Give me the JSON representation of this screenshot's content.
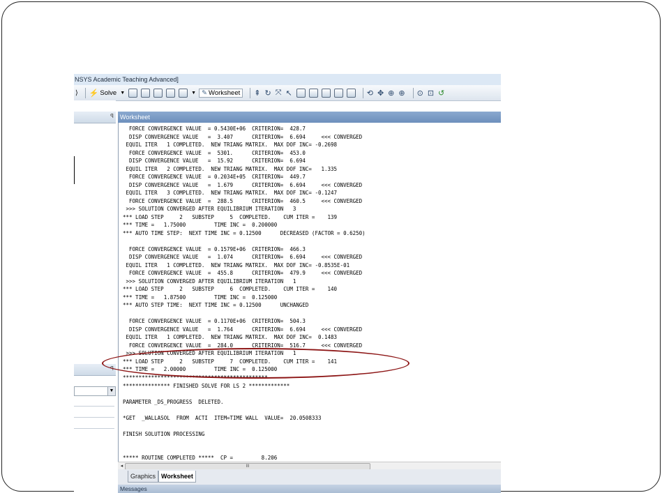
{
  "window": {
    "title": "NSYS Academic Teaching Advanced]"
  },
  "toolbar": {
    "solve_label": "Solve",
    "worksheet_label": "Worksheet"
  },
  "worksheet": {
    "header": "Worksheet",
    "lines": [
      "  FORCE CONVERGENCE VALUE  = 0.5430E+06  CRITERION=  428.7",
      "  DISP CONVERGENCE VALUE   =  3.407      CRITERION=  6.694     <<< CONVERGED",
      " EQUIL ITER   1 COMPLETED.  NEW TRIANG MATRIX.  MAX DOF INC= -0.2698",
      "  FORCE CONVERGENCE VALUE  =  5301.      CRITERION=  453.0",
      "  DISP CONVERGENCE VALUE   =  15.92      CRITERION=  6.694",
      " EQUIL ITER   2 COMPLETED.  NEW TRIANG MATRIX.  MAX DOF INC=   1.335",
      "  FORCE CONVERGENCE VALUE  = 0.2034E+05  CRITERION=  449.7",
      "  DISP CONVERGENCE VALUE   =  1.679      CRITERION=  6.694     <<< CONVERGED",
      " EQUIL ITER   3 COMPLETED.  NEW TRIANG MATRIX.  MAX DOF INC= -0.1247",
      "  FORCE CONVERGENCE VALUE  =  288.5      CRITERION=  460.5     <<< CONVERGED",
      " >>> SOLUTION CONVERGED AFTER EQUILIBRIUM ITERATION   3",
      "*** LOAD STEP     2   SUBSTEP     5  COMPLETED.    CUM ITER =    139",
      "*** TIME =   1.75000         TIME INC =  0.200000",
      "*** AUTO TIME STEP:  NEXT TIME INC = 0.12500      DECREASED (FACTOR = 0.6250)",
      "",
      "  FORCE CONVERGENCE VALUE  = 0.1579E+06  CRITERION=  466.3",
      "  DISP CONVERGENCE VALUE   =  1.074      CRITERION=  6.694     <<< CONVERGED",
      " EQUIL ITER   1 COMPLETED.  NEW TRIANG MATRIX.  MAX DOF INC= -0.8535E-01",
      "  FORCE CONVERGENCE VALUE  =  455.8      CRITERION=  479.9     <<< CONVERGED",
      " >>> SOLUTION CONVERGED AFTER EQUILIBRIUM ITERATION   1",
      "*** LOAD STEP     2   SUBSTEP     6  COMPLETED.    CUM ITER =    140",
      "*** TIME =   1.87500         TIME INC =  0.125000",
      "*** AUTO STEP TIME:  NEXT TIME INC = 0.12500      UNCHANGED",
      "",
      "  FORCE CONVERGENCE VALUE  = 0.1170E+06  CRITERION=  504.3",
      "  DISP CONVERGENCE VALUE   =  1.764      CRITERION=  6.694     <<< CONVERGED",
      " EQUIL ITER   1 COMPLETED.  NEW TRIANG MATRIX.  MAX DOF INC=  0.1483",
      "  FORCE CONVERGENCE VALUE  =  284.0      CRITERION=  516.7     <<< CONVERGED",
      " >>> SOLUTION CONVERGED AFTER EQUILIBRIUM ITERATION   1",
      "*** LOAD STEP     2   SUBSTEP     7  COMPLETED.    CUM ITER =    141",
      "*** TIME =   2.00000         TIME INC =  0.125000",
      "**********************************************",
      "*************** FINISHED SOLVE FOR LS 2 *************",
      "",
      "PARAMETER _DS_PROGRESS  DELETED.",
      "",
      "*GET  _WALLASOL  FROM  ACTI  ITEM=TIME WALL  VALUE=  20.0508333",
      "",
      "FINISH SOLUTION PROCESSING",
      "",
      "",
      "***** ROUTINE COMPLETED *****  CP =         8.206"
    ]
  },
  "tabs": {
    "graphics": "Graphics",
    "worksheet": "Worksheet"
  },
  "messages": {
    "title": "Messages"
  },
  "scrollbar": {
    "thumb_grip": "III"
  },
  "colors": {
    "highlight_ellipse": "#8c1414",
    "worksheet_header": "#7d9ec8"
  }
}
